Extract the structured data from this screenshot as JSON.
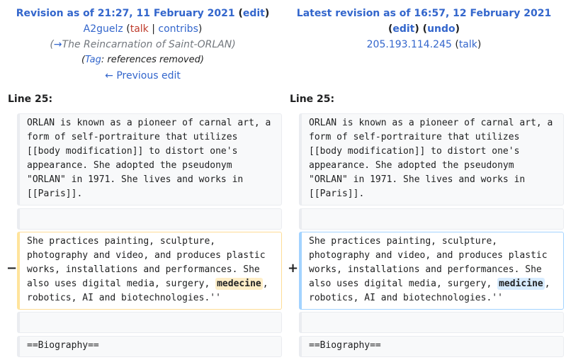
{
  "left": {
    "title": "Revision as of 21:27, 11 February 2021",
    "edit": "edit",
    "user": "A2guelz",
    "talk": "talk",
    "sep": "|",
    "contribs": "contribs",
    "comment_arrow": "→",
    "comment": "The Reincarnation of Saint-ORLAN",
    "tag_label": "Tag",
    "tag_text": ": references removed",
    "prev_edit": "← Previous edit"
  },
  "right": {
    "title": "Latest revision as of 16:57, 12 February 2021",
    "edit": "edit",
    "undo": "undo",
    "user": "205.193.114.245",
    "talk": "talk"
  },
  "line_label_left": "Line 25:",
  "line_label_right": "Line 25:",
  "diff": {
    "para1": "ORLAN is known as a pioneer of carnal art, a form of self-portraiture that utilizes [[body modification]] to distort one's appearance. She adopted the pseudonym \"ORLAN\" in 1971. She lives and works in [[Paris]].",
    "para2_before": "She practices painting, sculpture, photography and video, and produces plastic works, installations and performances. She also uses digital media, surgery, ",
    "para2_deleted": "medecine",
    "para2_added": "medicine",
    "para2_after": ", robotics, AI and biotechnologies.''",
    "para3": "==Biography=="
  },
  "signs": {
    "minus": "−",
    "plus": "+"
  },
  "colors": {
    "link": "#3366cc",
    "red_link": "#bf3c2c",
    "deleted_border": "#ffe49c",
    "added_border": "#a3d3ff",
    "deleted_highlight": "#feeec8",
    "added_highlight": "#d8ecff"
  }
}
